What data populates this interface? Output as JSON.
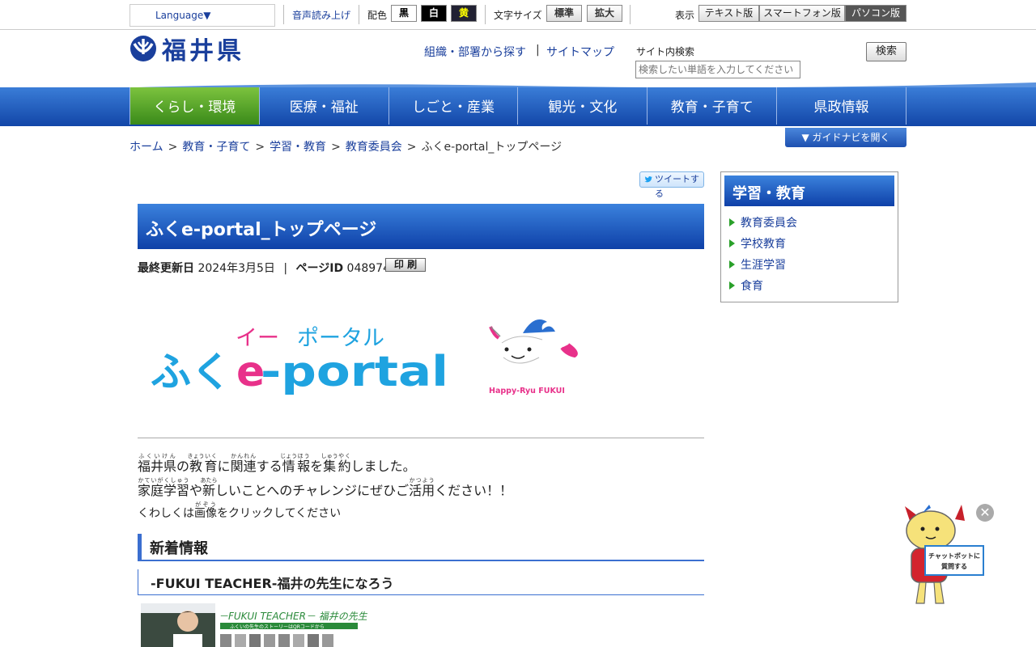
{
  "utility": {
    "language": "Language▼",
    "voice": "音声読み上げ",
    "color_label": "配色",
    "color_black": "黒",
    "color_white": "白",
    "color_yellow": "黄",
    "fontsize_label": "文字サイズ",
    "fontsize_normal": "標準",
    "fontsize_large": "拡大",
    "display_label": "表示",
    "display_text": "テキスト版",
    "display_smartphone": "スマートフォン版",
    "display_pc": "パソコン版"
  },
  "header": {
    "site_name": "福井県",
    "link_org": "組織・部署から探す",
    "link_divider": "|",
    "link_sitemap": "サイトマップ",
    "search_label": "サイト内検索",
    "search_placeholder": "検索したい単語を入力してください",
    "search_button": "検索"
  },
  "nav": {
    "items": [
      "くらし・環境",
      "医療・福祉",
      "しごと・産業",
      "観光・文化",
      "教育・子育て",
      "県政情報"
    ],
    "guide_button": "▼ ガイドナビを開く"
  },
  "breadcrumb": {
    "items": [
      "ホーム",
      "教育・子育て",
      "学習・教育",
      "教育委員会"
    ],
    "current": "ふくe-portal_トップページ",
    "separator": ">"
  },
  "page": {
    "tweet": "ツイートする",
    "title": "ふくe-portal_トップページ",
    "updated_label": "最終更新日",
    "updated_date": "2024年3月5日",
    "meta_divider": "|",
    "page_id_label": "ページID",
    "page_id": "048974",
    "print": "印 刷",
    "banner": {
      "ruby_i": "イー",
      "ruby_portal": "ポータル",
      "fuku": "ふく",
      "e": "e",
      "portal": "-portal",
      "mascot_caption": "Happy-Ryu  FUKUI"
    },
    "intro_line1_tail": "に",
    "intro_line1_end": "を",
    "intro_line1_close": "しました。",
    "intro_line2_mid": "や",
    "intro_line2_tail": "しいことへのチャレンジにぜひご",
    "intro_line2_end": "ください！！",
    "intro_line3_head": "くわしくは",
    "intro_line3_tail": "をクリックしてください",
    "ruby": {
      "fukuiken": "福井県",
      "fukuiken_r": "ふくいけん",
      "no": "の",
      "kyo": "教",
      "kyo_r": "きょう",
      "iku": "育",
      "iku_r": "いく",
      "kanren": "関連",
      "kanren_r": "かんれん",
      "suru": "する",
      "jo": "情",
      "jo_r": "じょう",
      "ho": "報",
      "ho_r": "ほう",
      "shu": "集",
      "shu_r": "しゅう",
      "yaku": "約",
      "yaku_r": "やく",
      "katei": "家庭学習",
      "katei_r": "かていがくしゅう",
      "atara": "新",
      "atara_r": "あたら",
      "katsuyo": "活用",
      "katsuyo_r": "かつよう",
      "gazo": "画像",
      "gazo_r": "がぞう"
    },
    "news_heading": "新着情報",
    "teacher_heading": "-FUKUI TEACHER-福井の先生になろう",
    "teacher_banner_title": "－FUKUI TEACHER－ 福井の先生になろう",
    "teacher_banner_sub": "ふくいの先生のストーリーはQRコードから"
  },
  "sidebar": {
    "heading": "学習・教育",
    "items": [
      "教育委員会",
      "学校教育",
      "生涯学習",
      "食育"
    ]
  },
  "chatbot": {
    "close": "✕",
    "sign_line1": "チャットボットに",
    "sign_line2": "質問する"
  },
  "colors": {
    "brand_blue": "#1a3f9c",
    "nav_blue": "#1246a8",
    "nav_active_green": "#3a8a1a",
    "portal_blue": "#1fa3e0",
    "portal_pink": "#e8318a"
  }
}
